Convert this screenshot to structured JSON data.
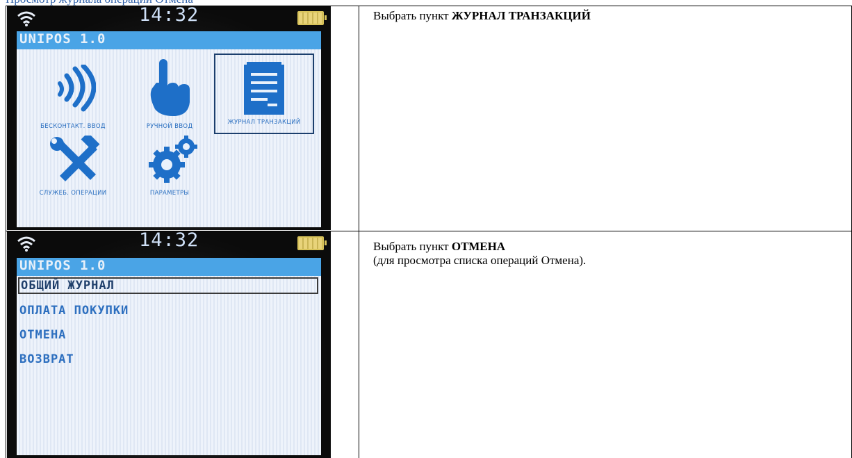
{
  "heading_fragment": "Просмотр журнала операций Отмена",
  "device1": {
    "time": "14:32",
    "title": "UNIPOS 1.0",
    "tiles": [
      {
        "label": "БЕСКОНТАКТ. ВВОД",
        "icon": "contactless-icon"
      },
      {
        "label": "РУЧНОЙ ВВОД",
        "icon": "hand-pointer-icon"
      },
      {
        "label": "ЖУРНАЛ ТРАНЗАКЦИЙ",
        "icon": "journal-icon"
      },
      {
        "label": "СЛУЖЕБ. ОПЕРАЦИИ",
        "icon": "tools-icon"
      },
      {
        "label": "ПАРАМЕТРЫ",
        "icon": "gears-icon"
      }
    ]
  },
  "device2": {
    "time": "14:32",
    "title": "UNIPOS 1.0",
    "items": [
      "ОБЩИЙ ЖУРНАЛ",
      "ОПЛАТА ПОКУПКИ",
      "ОТМЕНА",
      "ВОЗВРАТ"
    ]
  },
  "step1": {
    "prefix": "Выбрать пункт ",
    "bold": "ЖУРНАЛ ТРАНЗАКЦИЙ"
  },
  "step2": {
    "prefix": "Выбрать пункт ",
    "bold": "ОТМЕНА",
    "note": "(для просмотра списка операций Отмена)."
  },
  "colors": {
    "screen_accent": "#4aa4e6",
    "icon_blue": "#1e6fc8",
    "heading_blue": "#2e5fa8"
  }
}
